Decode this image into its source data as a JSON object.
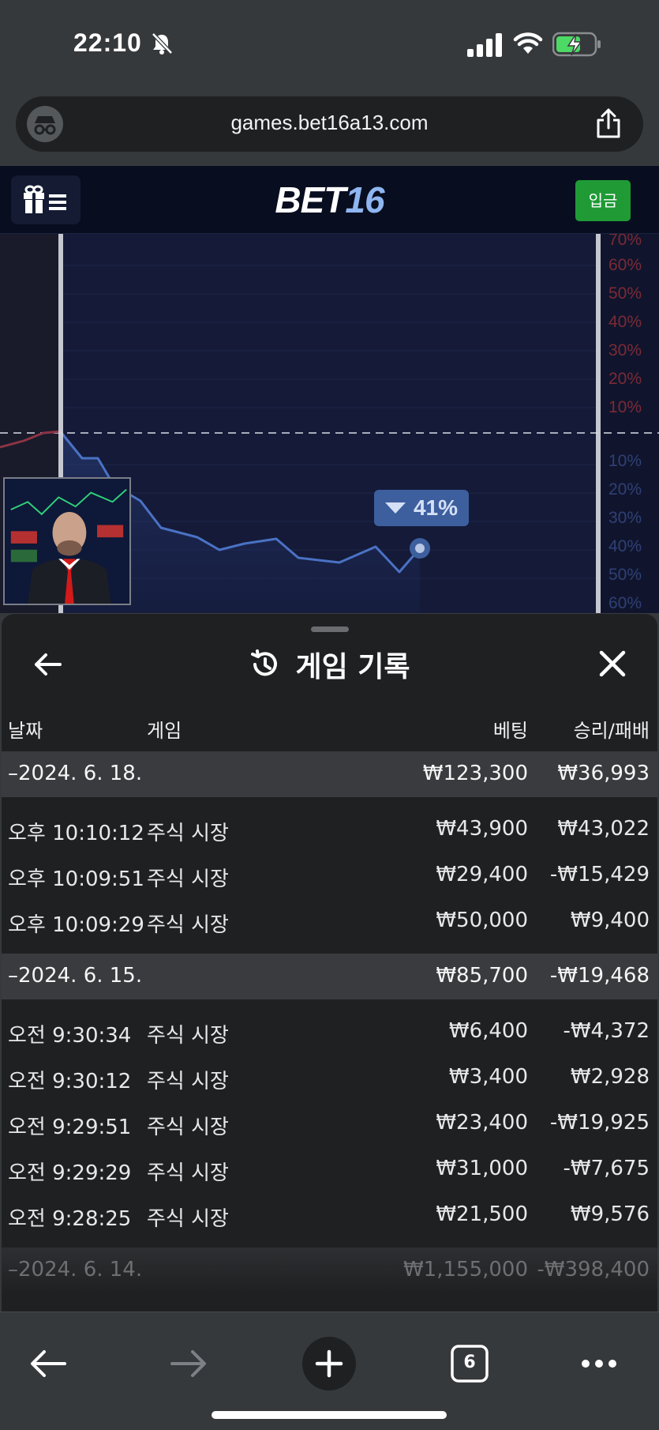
{
  "status": {
    "time": "22:10",
    "icons": [
      "bell-slash-icon",
      "signal-icon",
      "wifi-icon",
      "battery-charging-icon"
    ]
  },
  "browser": {
    "url": "games.bet16a13.com",
    "icons": [
      "incognito-icon",
      "share-icon"
    ],
    "tab_count": "6"
  },
  "site": {
    "logo_bet": "BET",
    "logo_num": "16",
    "deposit_label": "입금",
    "colors": {
      "header_bg": "#080d1f",
      "deposit": "#1f9a35",
      "logo_accent": "#8fb6f0"
    }
  },
  "chart_data": {
    "type": "line",
    "y_axis_labels_up": [
      "70%",
      "60%",
      "50%",
      "40%",
      "30%",
      "20%",
      "10%"
    ],
    "y_axis_labels_down": [
      "10%",
      "20%",
      "30%",
      "40%",
      "50%",
      "60%"
    ],
    "current_label": "41%",
    "direction": "down",
    "line_color": "#4a72c4"
  },
  "history": {
    "title": "게임 기록",
    "columns": {
      "date": "날짜",
      "game": "게임",
      "bet": "베팅",
      "result": "승리/패배"
    },
    "groups": [
      {
        "date": "–2024. 6. 18.",
        "bet_total": "₩123,300",
        "result_total": "₩36,993",
        "entries": [
          {
            "time": "오후 10:10:12",
            "game": "주식 시장",
            "bet": "₩43,900",
            "result": "₩43,022"
          },
          {
            "time": "오후 10:09:51",
            "game": "주식 시장",
            "bet": "₩29,400",
            "result": "-₩15,429"
          },
          {
            "time": "오후 10:09:29",
            "game": "주식 시장",
            "bet": "₩50,000",
            "result": "₩9,400"
          }
        ]
      },
      {
        "date": "–2024. 6. 15.",
        "bet_total": "₩85,700",
        "result_total": "-₩19,468",
        "entries": [
          {
            "time": "오전 9:30:34",
            "game": "주식 시장",
            "bet": "₩6,400",
            "result": "-₩4,372"
          },
          {
            "time": "오전 9:30:12",
            "game": "주식 시장",
            "bet": "₩3,400",
            "result": "₩2,928"
          },
          {
            "time": "오전 9:29:51",
            "game": "주식 시장",
            "bet": "₩23,400",
            "result": "-₩19,925"
          },
          {
            "time": "오전 9:29:29",
            "game": "주식 시장",
            "bet": "₩31,000",
            "result": "-₩7,675"
          },
          {
            "time": "오전 9:28:25",
            "game": "주식 시장",
            "bet": "₩21,500",
            "result": "₩9,576"
          }
        ]
      },
      {
        "date": "–2024. 6. 14.",
        "bet_total": "₩1,155,000",
        "result_total": "-₩398,400",
        "entries": []
      }
    ]
  },
  "toolbar": {
    "icons": [
      "back-arrow-icon",
      "forward-arrow-icon",
      "new-tab-plus-icon",
      "tabs-icon",
      "more-dots-icon"
    ]
  }
}
